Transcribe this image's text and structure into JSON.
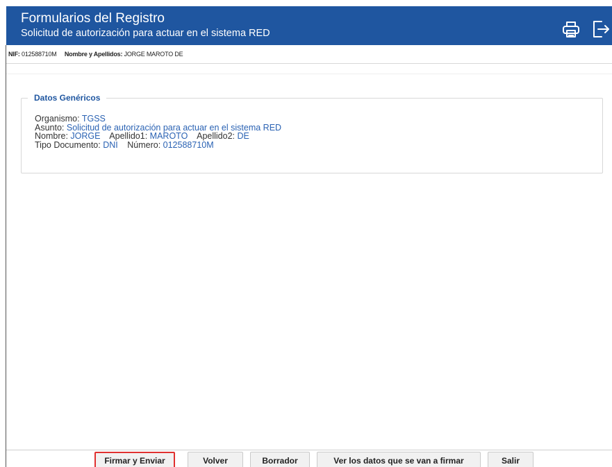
{
  "header": {
    "title": "Formularios del Registro",
    "subtitle": "Solicitud de autorización para actuar en el sistema RED",
    "print_icon": "printer-icon",
    "logout_icon": "logout-icon"
  },
  "userbar": {
    "nif_label": "NIF:",
    "nif_value": "012588710M",
    "name_label": "Nombre y Apellidos:",
    "name_value": "JORGE MAROTO DE"
  },
  "generic": {
    "legend": "Datos Genéricos",
    "organismo_label": "Organismo:",
    "organismo_value": "TGSS",
    "asunto_label": "Asunto:",
    "asunto_value": "Solicitud de autorización para actuar en el sistema RED",
    "nombre_label": "Nombre:",
    "nombre_value": "JORGE",
    "apellido1_label": "Apellido1:",
    "apellido1_value": "MAROTO",
    "apellido2_label": "Apellido2:",
    "apellido2_value": "DE",
    "tipo_doc_label": "Tipo Documento:",
    "tipo_doc_value": "DNI",
    "numero_label": "Número:",
    "numero_value": "012588710M"
  },
  "actions": {
    "sign_send": "Firmar y Enviar",
    "back": "Volver",
    "draft": "Borrador",
    "view_data": "Ver los datos que se van a firmar",
    "exit": "Salir"
  },
  "colors": {
    "header_bg": "#1f56a0",
    "value_text": "#2a62b3",
    "highlight_border": "#e0302f"
  }
}
